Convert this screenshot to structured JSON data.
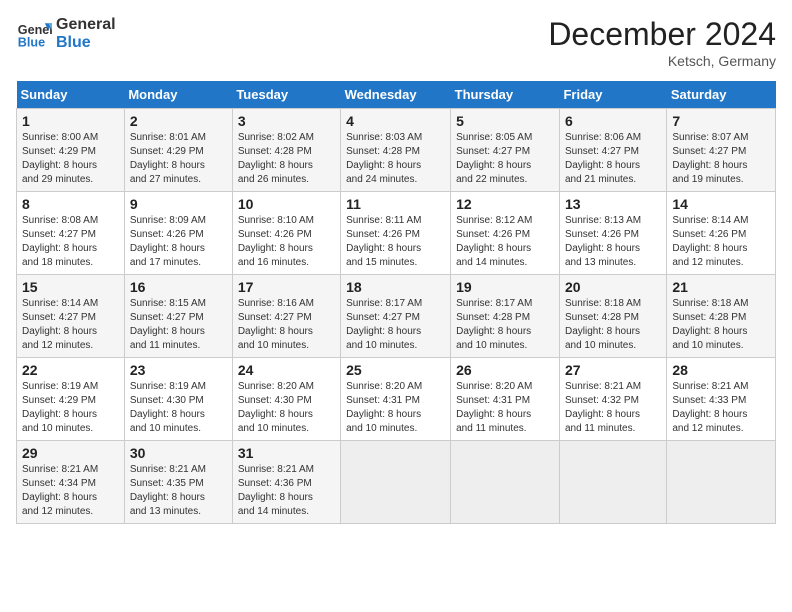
{
  "header": {
    "logo_line1": "General",
    "logo_line2": "Blue",
    "month": "December 2024",
    "location": "Ketsch, Germany"
  },
  "days_of_week": [
    "Sunday",
    "Monday",
    "Tuesday",
    "Wednesday",
    "Thursday",
    "Friday",
    "Saturday"
  ],
  "weeks": [
    [
      {
        "day": "1",
        "info": "Sunrise: 8:00 AM\nSunset: 4:29 PM\nDaylight: 8 hours\nand 29 minutes."
      },
      {
        "day": "2",
        "info": "Sunrise: 8:01 AM\nSunset: 4:29 PM\nDaylight: 8 hours\nand 27 minutes."
      },
      {
        "day": "3",
        "info": "Sunrise: 8:02 AM\nSunset: 4:28 PM\nDaylight: 8 hours\nand 26 minutes."
      },
      {
        "day": "4",
        "info": "Sunrise: 8:03 AM\nSunset: 4:28 PM\nDaylight: 8 hours\nand 24 minutes."
      },
      {
        "day": "5",
        "info": "Sunrise: 8:05 AM\nSunset: 4:27 PM\nDaylight: 8 hours\nand 22 minutes."
      },
      {
        "day": "6",
        "info": "Sunrise: 8:06 AM\nSunset: 4:27 PM\nDaylight: 8 hours\nand 21 minutes."
      },
      {
        "day": "7",
        "info": "Sunrise: 8:07 AM\nSunset: 4:27 PM\nDaylight: 8 hours\nand 19 minutes."
      }
    ],
    [
      {
        "day": "8",
        "info": "Sunrise: 8:08 AM\nSunset: 4:27 PM\nDaylight: 8 hours\nand 18 minutes."
      },
      {
        "day": "9",
        "info": "Sunrise: 8:09 AM\nSunset: 4:26 PM\nDaylight: 8 hours\nand 17 minutes."
      },
      {
        "day": "10",
        "info": "Sunrise: 8:10 AM\nSunset: 4:26 PM\nDaylight: 8 hours\nand 16 minutes."
      },
      {
        "day": "11",
        "info": "Sunrise: 8:11 AM\nSunset: 4:26 PM\nDaylight: 8 hours\nand 15 minutes."
      },
      {
        "day": "12",
        "info": "Sunrise: 8:12 AM\nSunset: 4:26 PM\nDaylight: 8 hours\nand 14 minutes."
      },
      {
        "day": "13",
        "info": "Sunrise: 8:13 AM\nSunset: 4:26 PM\nDaylight: 8 hours\nand 13 minutes."
      },
      {
        "day": "14",
        "info": "Sunrise: 8:14 AM\nSunset: 4:26 PM\nDaylight: 8 hours\nand 12 minutes."
      }
    ],
    [
      {
        "day": "15",
        "info": "Sunrise: 8:14 AM\nSunset: 4:27 PM\nDaylight: 8 hours\nand 12 minutes."
      },
      {
        "day": "16",
        "info": "Sunrise: 8:15 AM\nSunset: 4:27 PM\nDaylight: 8 hours\nand 11 minutes."
      },
      {
        "day": "17",
        "info": "Sunrise: 8:16 AM\nSunset: 4:27 PM\nDaylight: 8 hours\nand 10 minutes."
      },
      {
        "day": "18",
        "info": "Sunrise: 8:17 AM\nSunset: 4:27 PM\nDaylight: 8 hours\nand 10 minutes."
      },
      {
        "day": "19",
        "info": "Sunrise: 8:17 AM\nSunset: 4:28 PM\nDaylight: 8 hours\nand 10 minutes."
      },
      {
        "day": "20",
        "info": "Sunrise: 8:18 AM\nSunset: 4:28 PM\nDaylight: 8 hours\nand 10 minutes."
      },
      {
        "day": "21",
        "info": "Sunrise: 8:18 AM\nSunset: 4:28 PM\nDaylight: 8 hours\nand 10 minutes."
      }
    ],
    [
      {
        "day": "22",
        "info": "Sunrise: 8:19 AM\nSunset: 4:29 PM\nDaylight: 8 hours\nand 10 minutes."
      },
      {
        "day": "23",
        "info": "Sunrise: 8:19 AM\nSunset: 4:30 PM\nDaylight: 8 hours\nand 10 minutes."
      },
      {
        "day": "24",
        "info": "Sunrise: 8:20 AM\nSunset: 4:30 PM\nDaylight: 8 hours\nand 10 minutes."
      },
      {
        "day": "25",
        "info": "Sunrise: 8:20 AM\nSunset: 4:31 PM\nDaylight: 8 hours\nand 10 minutes."
      },
      {
        "day": "26",
        "info": "Sunrise: 8:20 AM\nSunset: 4:31 PM\nDaylight: 8 hours\nand 11 minutes."
      },
      {
        "day": "27",
        "info": "Sunrise: 8:21 AM\nSunset: 4:32 PM\nDaylight: 8 hours\nand 11 minutes."
      },
      {
        "day": "28",
        "info": "Sunrise: 8:21 AM\nSunset: 4:33 PM\nDaylight: 8 hours\nand 12 minutes."
      }
    ],
    [
      {
        "day": "29",
        "info": "Sunrise: 8:21 AM\nSunset: 4:34 PM\nDaylight: 8 hours\nand 12 minutes."
      },
      {
        "day": "30",
        "info": "Sunrise: 8:21 AM\nSunset: 4:35 PM\nDaylight: 8 hours\nand 13 minutes."
      },
      {
        "day": "31",
        "info": "Sunrise: 8:21 AM\nSunset: 4:36 PM\nDaylight: 8 hours\nand 14 minutes."
      },
      {
        "day": "",
        "info": ""
      },
      {
        "day": "",
        "info": ""
      },
      {
        "day": "",
        "info": ""
      },
      {
        "day": "",
        "info": ""
      }
    ]
  ]
}
